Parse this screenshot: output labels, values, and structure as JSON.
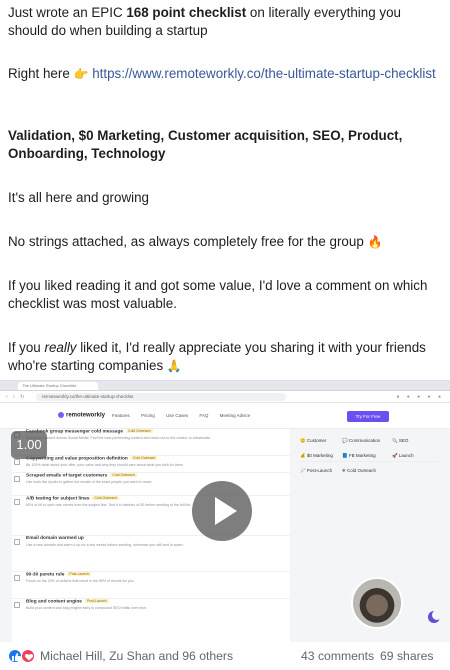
{
  "post": {
    "p1_a": "Just wrote an EPIC ",
    "p1_b": "168 point checklist",
    "p1_c": " on literally everything you should do when building a startup",
    "p2_a": "Right here ",
    "p2_emoji": "👉",
    "p2_link": "https://www.remoteworkly.co/the-ultimate-startup-checklist",
    "p3": "Validation, $0 Marketing, Customer acquisition, SEO, Product, Onboarding, Technology",
    "p4": "It's all here and growing",
    "p5": "No strings attached, as always completely free for the group ",
    "p5_emoji": "🔥",
    "p6": "If you liked reading it and got some value, I'd love a comment on which checklist was most valuable.",
    "p7_a": "If you ",
    "p7_em": "really",
    "p7_b": " liked it, I'd really appreciate you sharing it with your friends who're starting companies ",
    "p7_emoji": "🙏"
  },
  "video": {
    "speed": "1.00",
    "tab_title": "The Ultimate Startup Checklist",
    "url": "remoteworkly.co/the-ultimate-startup-checklist",
    "site_logo": "remoteworkly",
    "nav_links": [
      "Features",
      "Pricing",
      "Use Cases",
      "FAQ",
      "Meeting Advice"
    ],
    "cta": "Try For Free",
    "chips": [
      "Customer",
      "Communication",
      "SEO",
      "$0 Marketing",
      "FB Marketing",
      "Launch",
      "Post-Launch",
      "Cold Outreach"
    ],
    "items": [
      {
        "title": "Facebook group messenger cold message",
        "tag": "Cold Outreach",
        "desc": "Search for content across Social Media. Find the best-performing content and reach out to the creator to collaborate."
      },
      {
        "title": "Copywriting and value proposition definition",
        "tag": "Cold Outreach",
        "desc": "Be 100% clear about your offer, your value and why they should care about what you built for them."
      },
      {
        "title": "Scraped emails of target customers",
        "tag": "Cold Outreach",
        "desc": "Use tools like Apollo to gather the emails of the exact people you want to reach."
      },
      {
        "title": "A/B testing for subject lines",
        "tag": "Cold Outreach",
        "desc": "60% of lift in open rate comes from the subject line. Test it in batches of 50 before sending to the full list."
      },
      {
        "title": "Email domain warmed up",
        "tag": "Cold Outreach",
        "desc": "Use a new domain and warm it up for a few weeks before sending, otherwise you will land in spam."
      },
      {
        "title": "90-30 paretu rule",
        "tag": "Post-Launch",
        "desc": "Focus on the 20% of actions that result in the 80% of results for you."
      },
      {
        "title": "Blog and content engine",
        "tag": "Post-Launch",
        "desc": "Build your content and blog engine early to compound SEO traffic over time."
      }
    ]
  },
  "footer": {
    "names": "Michael Hill, Zu Shan and 96 others",
    "comments": "43 comments",
    "shares": "69 shares"
  },
  "colors": {
    "link": "#385898",
    "like": "#1877f2",
    "love": "#f33e58",
    "cta": "#6b4ff0"
  }
}
